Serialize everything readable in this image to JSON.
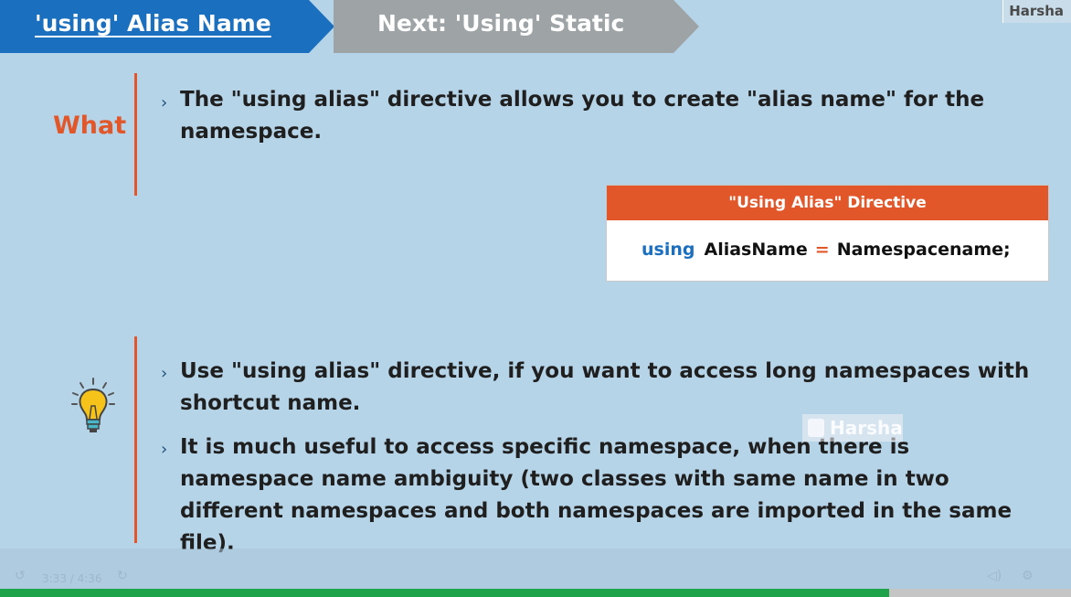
{
  "header": {
    "active_tab": "'using' Alias Name",
    "next_tab": "Next: 'Using' Static",
    "brand": "Harsha"
  },
  "what": {
    "label": "What",
    "text": "The \"using alias\" directive allows you to create \"alias name\" for the namespace."
  },
  "directive_box": {
    "title": "\"Using Alias\" Directive",
    "keyword": "using",
    "alias": "AliasName",
    "equals": "=",
    "target": "Namespacename;"
  },
  "tips": [
    "Use \"using alias\" directive, if you want to access long namespaces with shortcut name.",
    "It is much useful to access specific namespace, when there is namespace name ambiguity (two classes with same name in two different namespaces and both namespaces are imported in the same file)."
  ],
  "watermark": "Harsha",
  "player": {
    "time": "3:33 / 4:36",
    "progress": 0.83
  },
  "colors": {
    "accent": "#e2572a",
    "primary": "#1b6fbf",
    "background": "#b6d4e8",
    "progress": "#1ea34a"
  }
}
